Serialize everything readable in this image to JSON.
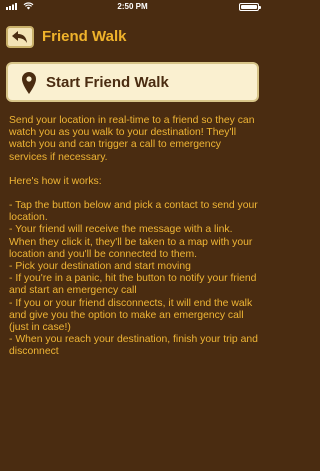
{
  "status": {
    "time": "2:50 PM"
  },
  "nav": {
    "title": "Friend Walk"
  },
  "start_button": {
    "label": "Start Friend Walk"
  },
  "content": {
    "intro": "Send your location in real-time to a friend so they can watch you as you walk to your destination! They'll watch you and can trigger a call to emergency services if necessary.",
    "how_heading": "Here's how it works:",
    "steps": [
      "- Tap the button below and pick a contact to send your location.",
      "- Your friend will receive the message with a link. When they click it, they'll be taken to a map with your location and you'll be connected to them.",
      "- Pick your destination and start moving",
      "- If you're in a panic, hit the button to notify your friend and start an emergency call",
      "- If you or your friend disconnects, it will end the walk and give you the option to make an emergency call (just in case!)",
      "- When you reach your destination, finish your trip and disconnect"
    ]
  },
  "colors": {
    "background": "#4a2c11",
    "accent": "#f0b32b",
    "button_bg": "#faf0d0",
    "button_border": "#d7c488"
  },
  "icons": {
    "back": "back-arrow-icon",
    "pin": "map-pin-icon",
    "wifi": "wifi-icon",
    "battery": "battery-icon"
  }
}
